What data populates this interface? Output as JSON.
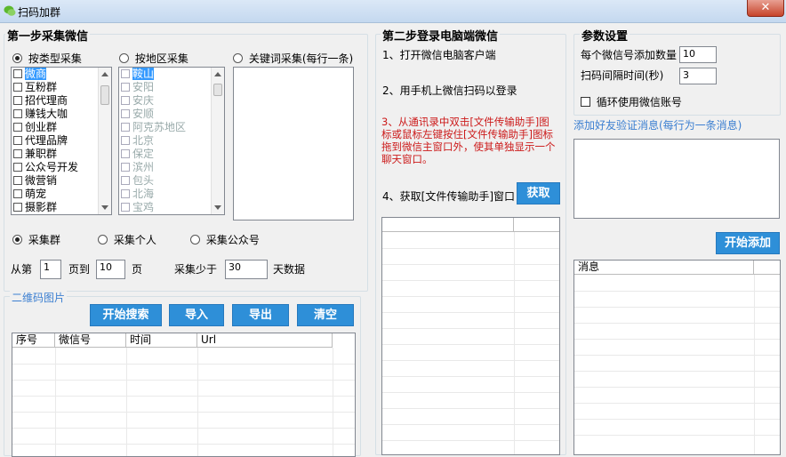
{
  "window": {
    "title": "扫码加群",
    "close_label": "✕"
  },
  "step1": {
    "legend": "第一步采集微信",
    "mode_type": "按类型采集",
    "mode_region": "按地区采集",
    "mode_keyword": "关键词采集(每行一条)",
    "type_list": [
      "微商",
      "互粉群",
      "招代理商",
      "赚钱大咖",
      "创业群",
      "代理品牌",
      "兼职群",
      "公众号开发",
      "微营销",
      "萌宠",
      "摄影群"
    ],
    "region_list": [
      "鞍山",
      "安阳",
      "安庆",
      "安顺",
      "阿克苏地区",
      "北京",
      "保定",
      "滨州",
      "包头",
      "北海",
      "宝鸡"
    ],
    "target_group": "采集群",
    "target_person": "采集个人",
    "target_official": "采集公众号",
    "page_from_label": "从第",
    "page_from_value": "1",
    "page_to_label": "页到",
    "page_to_value": "10",
    "page_unit": "页",
    "days_label": "采集少于",
    "days_value": "30",
    "days_unit": "天数据"
  },
  "qrcode": {
    "legend": "二维码图片",
    "btn_search": "开始搜索",
    "btn_import": "导入",
    "btn_export": "导出",
    "btn_clear": "清空",
    "columns": [
      "序号",
      "微信号",
      "时间",
      "Url"
    ]
  },
  "step2": {
    "legend": "第二步登录电脑端微信",
    "instr1": "1、打开微信电脑客户端",
    "instr2": "2、用手机上微信扫码以登录",
    "instr3": "3、从通讯录中双击[文件传输助手]图标或鼠标左键按住[文件传输助手]图标拖到微信主窗口外，使其单独显示一个聊天窗口。",
    "instr4": "4、获取[文件传输助手]窗口",
    "btn_get": "获取"
  },
  "params": {
    "legend": "参数设置",
    "add_count_label": "每个微信号添加数量",
    "add_count_value": "10",
    "interval_label": "扫码间隔时间(秒)",
    "interval_value": "3",
    "loop_label": "循环使用微信账号",
    "verify_label": "添加好友验证消息(每行为一条消息)",
    "btn_start_add": "开始添加",
    "msg_column": "消息"
  }
}
